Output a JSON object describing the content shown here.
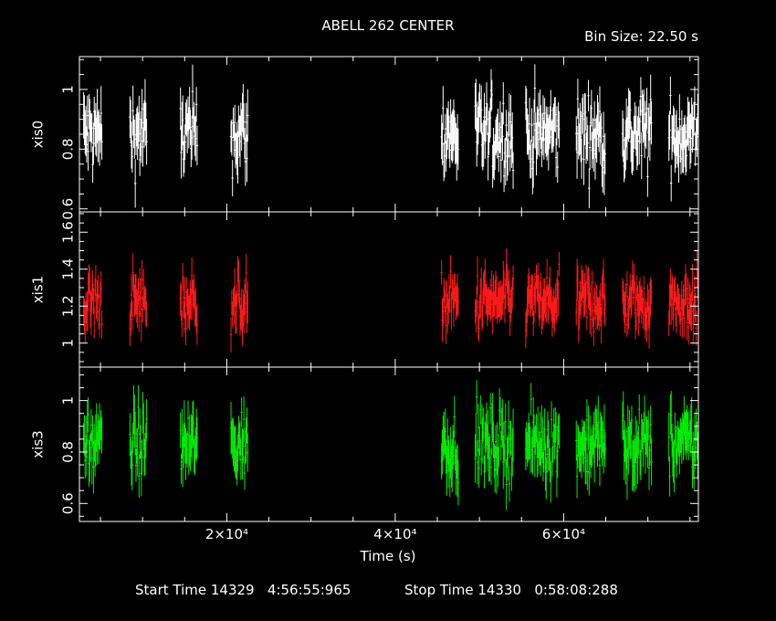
{
  "header": {
    "title": "ABELL 262 CENTER",
    "bin_size": "Bin Size: 22.50 s"
  },
  "footer": {
    "start": "Start Time 14329   4:56:55:965",
    "stop": "Stop Time 14330   0:58:08:288"
  },
  "chart_data": {
    "type": "scatter",
    "title": "ABELL 262 CENTER",
    "xlabel": "Time (s)",
    "xlim": [
      2500,
      76000
    ],
    "x_ticks": [
      {
        "value": 20000,
        "label": "2×10⁴"
      },
      {
        "value": 40000,
        "label": "4×10⁴"
      },
      {
        "value": 60000,
        "label": "6×10⁴"
      }
    ],
    "segments": [
      [
        3000,
        5200
      ],
      [
        8500,
        10500
      ],
      [
        14500,
        16500
      ],
      [
        20500,
        22500
      ],
      [
        45500,
        47500
      ],
      [
        49500,
        54000
      ],
      [
        55500,
        59500
      ],
      [
        61500,
        65000
      ],
      [
        67000,
        70500
      ],
      [
        72500,
        76000
      ]
    ],
    "panels": [
      {
        "ylabel": "xis0",
        "color": "#ffffff",
        "ylim": [
          0.59,
          1.11
        ],
        "y_ticks": [
          {
            "value": 0.6,
            "label": "0.6"
          },
          {
            "value": 0.8,
            "label": "0.8"
          },
          {
            "value": 1.0,
            "label": "1"
          }
        ],
        "mean": 0.85,
        "spread": 0.09,
        "err": 0.07
      },
      {
        "ylabel": "xis1",
        "color": "#ff1a1a",
        "ylim": [
          0.87,
          1.71
        ],
        "y_ticks": [
          {
            "value": 1.0,
            "label": "1"
          },
          {
            "value": 1.2,
            "label": "1.2"
          },
          {
            "value": 1.4,
            "label": "1.4"
          },
          {
            "value": 1.6,
            "label": "1.6"
          }
        ],
        "mean": 1.22,
        "spread": 0.11,
        "err": 0.09
      },
      {
        "ylabel": "xis3",
        "color": "#00ee00",
        "ylim": [
          0.53,
          1.13
        ],
        "y_ticks": [
          {
            "value": 0.6,
            "label": "0.6"
          },
          {
            "value": 0.8,
            "label": "0.8"
          },
          {
            "value": 1.0,
            "label": "1"
          }
        ],
        "mean": 0.83,
        "spread": 0.09,
        "err": 0.08
      }
    ]
  }
}
